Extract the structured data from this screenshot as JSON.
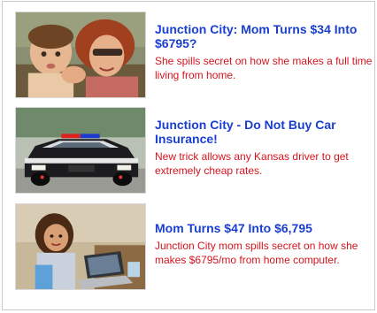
{
  "ads": [
    {
      "title": "Junction City: Mom Turns $34 Into $6795?",
      "description": "She spills secret on how she makes a full time living from home.",
      "image_icon": "mother-child-photo"
    },
    {
      "title": "Junction City - Do Not Buy Car Insurance!",
      "description": "New trick allows any Kansas driver to get extremely cheap rates.",
      "image_icon": "police-car-photo"
    },
    {
      "title": "Mom Turns $47 Into $6,795",
      "description": "Junction City mom spills secret on how she makes $6795/mo from home computer.",
      "image_icon": "woman-laptop-photo"
    }
  ],
  "colors": {
    "title": "#1a3fd0",
    "description": "#d4141e",
    "border": "#c9c9c9"
  }
}
